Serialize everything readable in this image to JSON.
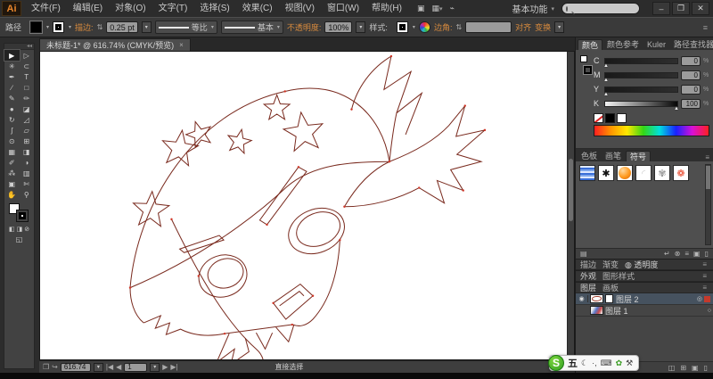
{
  "menu": {
    "logo": "Ai",
    "items": [
      "文件(F)",
      "编辑(E)",
      "对象(O)",
      "文字(T)",
      "选择(S)",
      "效果(C)",
      "视图(V)",
      "窗口(W)",
      "帮助(H)"
    ],
    "workspace": "基本功能",
    "icons": {
      "bridge": "▣",
      "workspace_grid": "▦",
      "cs_live": "⌁",
      "dropdown": "▾"
    },
    "window_controls": {
      "minimize": "–",
      "restore": "❐",
      "close": "✕"
    }
  },
  "control": {
    "selection_label": "路径",
    "stroke_label": "描边:",
    "stroke_value": "0.25 pt",
    "stepper": "⇅",
    "profile_label": "等比",
    "brush_label": "基本",
    "opacity_label": "不透明度:",
    "opacity_value": "100%",
    "style_label": "样式:",
    "corner_label": "边角:",
    "align_label": "对齐",
    "transform_label": "变换",
    "menu_icon": "≡"
  },
  "document_tab": {
    "title": "未标题-1* @ 616.74% (CMYK/预览)",
    "close": "×"
  },
  "toolbar": {
    "tools": [
      {
        "name": "selection",
        "glyph": "▶",
        "active": true
      },
      {
        "name": "direct-selection",
        "glyph": "▷",
        "active": false
      },
      {
        "name": "magic-wand",
        "glyph": "✳",
        "active": false
      },
      {
        "name": "lasso",
        "glyph": "⊂",
        "active": false
      },
      {
        "name": "pen",
        "glyph": "✒",
        "active": false
      },
      {
        "name": "type",
        "glyph": "T",
        "active": false
      },
      {
        "name": "line-segment",
        "glyph": "∕",
        "active": false
      },
      {
        "name": "rectangle",
        "glyph": "□",
        "active": false
      },
      {
        "name": "paintbrush",
        "glyph": "✎",
        "active": false
      },
      {
        "name": "pencil",
        "glyph": "✏",
        "active": false
      },
      {
        "name": "blob-brush",
        "glyph": "●",
        "active": false
      },
      {
        "name": "eraser",
        "glyph": "◪",
        "active": false
      },
      {
        "name": "rotate",
        "glyph": "↻",
        "active": false
      },
      {
        "name": "scale",
        "glyph": "◿",
        "active": false
      },
      {
        "name": "width",
        "glyph": "ʃ",
        "active": false
      },
      {
        "name": "free-transform",
        "glyph": "▱",
        "active": false
      },
      {
        "name": "shape-builder",
        "glyph": "⊙",
        "active": false
      },
      {
        "name": "perspective-grid",
        "glyph": "⊞",
        "active": false
      },
      {
        "name": "mesh",
        "glyph": "▦",
        "active": false
      },
      {
        "name": "gradient",
        "glyph": "◨",
        "active": false
      },
      {
        "name": "eyedropper",
        "glyph": "✐",
        "active": false
      },
      {
        "name": "blend",
        "glyph": "◑",
        "active": false
      },
      {
        "name": "symbol-sprayer",
        "glyph": "⁂",
        "active": false
      },
      {
        "name": "column-graph",
        "glyph": "▥",
        "active": false
      },
      {
        "name": "artboard",
        "glyph": "▣",
        "active": false
      },
      {
        "name": "slice",
        "glyph": "✄",
        "active": false
      },
      {
        "name": "hand",
        "glyph": "✋",
        "active": false
      },
      {
        "name": "zoom",
        "glyph": "⚲",
        "active": false
      }
    ],
    "bottom_icons": [
      {
        "name": "color-mode",
        "glyph": "◧"
      },
      {
        "name": "gradient-mode",
        "glyph": "◨"
      },
      {
        "name": "none-mode",
        "glyph": "⊘"
      }
    ],
    "screen_mode_icon": "◱"
  },
  "status_bar": {
    "left_icons": [
      "❒",
      "↪"
    ],
    "zoom_value": "616.74",
    "nav": {
      "first": "|◀",
      "prev": "◀",
      "artboard_value": "1",
      "next": "▶",
      "last": "▶|"
    },
    "tool_label": "直接选择",
    "right_icons": [
      "▶",
      "◀"
    ]
  },
  "panels": {
    "color": {
      "tabs": [
        "颜色",
        "颜色参考",
        "Kuler",
        "路径查找器"
      ],
      "menu_icon": "≡",
      "thumb_glyph": "▲",
      "channels": [
        {
          "label": "C",
          "value": "0"
        },
        {
          "label": "M",
          "value": "0"
        },
        {
          "label": "Y",
          "value": "0"
        },
        {
          "label": "K",
          "value": "100"
        }
      ],
      "unit": "%"
    },
    "symbols": {
      "tabs": [
        "色板",
        "画笔",
        "符号"
      ],
      "menu_icon": "≡",
      "thumb_glyphs": {
        "splat": "✱",
        "ring": "✾",
        "flower": "❁",
        "paper": "◜"
      },
      "footer_icons": [
        "▤",
        "↵",
        "⊗",
        "≡",
        "▣",
        "▯"
      ]
    },
    "collapsed1": {
      "tabs": [
        "描边",
        "渐变",
        "透明度"
      ],
      "lead_icon": "◍",
      "menu_icon": "≡"
    },
    "collapsed2": {
      "tabs": [
        "外观",
        "图形样式"
      ],
      "menu_icon": "≡"
    },
    "layers": {
      "tabs": [
        "图层",
        "画板"
      ],
      "menu_icon": "≡",
      "eye_icon": "◉",
      "rows": [
        {
          "name": "图层 2",
          "target": "◎",
          "selected": true
        },
        {
          "name": "图层 1",
          "target": "○",
          "selected": false
        }
      ],
      "footer_icons": [
        "◫",
        "⊞",
        "▣",
        "▯"
      ]
    }
  },
  "ime": {
    "logo": "S",
    "wubi": "五",
    "moon": "☾",
    "dots": "·,",
    "keyboard": "⌨",
    "leaf": "✿",
    "wrench": "⚒"
  }
}
